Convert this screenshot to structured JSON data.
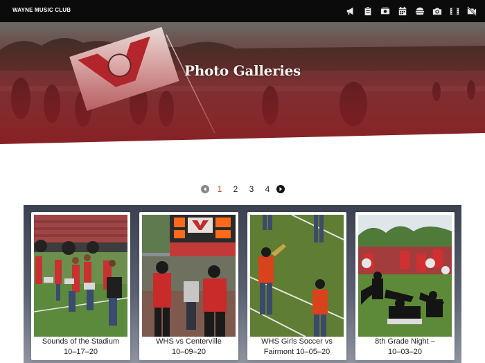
{
  "header": {
    "brand": "WAYNE MUSIC CLUB",
    "icons": [
      {
        "name": "megaphone-icon"
      },
      {
        "name": "clipboard-icon"
      },
      {
        "name": "cash-icon"
      },
      {
        "name": "calendar-icon"
      },
      {
        "name": "burger-icon"
      },
      {
        "name": "camera-icon"
      },
      {
        "name": "film-icon"
      },
      {
        "name": "no-video-icon"
      }
    ]
  },
  "hero": {
    "title": "Photo Galleries"
  },
  "pagination": {
    "pages": [
      "1",
      "2",
      "3",
      "4"
    ],
    "current": "1",
    "colors": {
      "active": "#c0392b",
      "arrow_prev": "#888888",
      "arrow_next": "#111111"
    }
  },
  "galleries": [
    {
      "title": "Sounds of the Stadium",
      "date": "10–17–20"
    },
    {
      "title": "WHS vs Centerville",
      "date": "10–09–20"
    },
    {
      "title": "WHS Girls Soccer vs",
      "date": "Fairmont 10–05–20"
    },
    {
      "title": "8th Grade Night –",
      "date": "10–03–20"
    }
  ],
  "colors": {
    "topbar": "#0b0b0c",
    "hero_accent": "#c0272d",
    "gallery_bg_top": "#3b4150",
    "gallery_bg_bottom": "#8f94a0"
  }
}
